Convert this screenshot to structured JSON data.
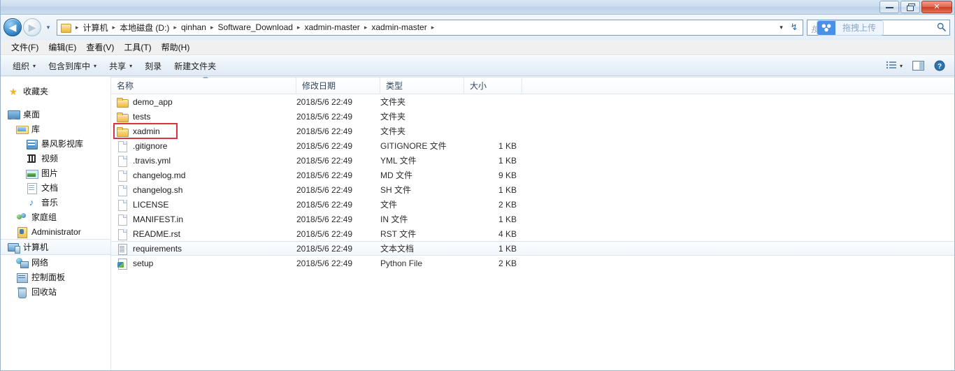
{
  "titlebar": {
    "minimize_label": "Minimize",
    "restore_label": "Restore",
    "close_label": "✕"
  },
  "nav": {
    "back_glyph": "◀",
    "forward_glyph": "▶",
    "recent_glyph": "▾",
    "address_dropdown_glyph": "▾",
    "refresh_glyph": "↯",
    "breadcrumbs": [
      "计算机",
      "本地磁盘 (D:)",
      "qinhan",
      "Software_Download",
      "xadmin-master",
      "xadmin-master"
    ],
    "separator": "▸"
  },
  "search": {
    "placeholder": "搜索",
    "baidu_overlay_text": "拖拽上传",
    "magnifier_glyph": "🔍",
    "accent_color": "#4a90e8"
  },
  "menubar": {
    "items": [
      "文件(F)",
      "编辑(E)",
      "查看(V)",
      "工具(T)",
      "帮助(H)"
    ]
  },
  "toolbar": {
    "items": [
      {
        "label": "组织",
        "has_caret": true
      },
      {
        "label": "包含到库中",
        "has_caret": true
      },
      {
        "label": "共享",
        "has_caret": true
      },
      {
        "label": "刻录",
        "has_caret": false
      },
      {
        "label": "新建文件夹",
        "has_caret": false
      }
    ],
    "caret_glyph": "▾",
    "view_icon": "list-view-icon",
    "preview_icon": "preview-pane-icon",
    "help_icon": "help-icon",
    "help_glyph": "?"
  },
  "sidebar": {
    "items": [
      {
        "label": "收藏夹",
        "icon": "star-icon",
        "depth": 0,
        "selected": false,
        "gap_after": true
      },
      {
        "label": "桌面",
        "icon": "monitor-icon",
        "depth": 0,
        "selected": false
      },
      {
        "label": "库",
        "icon": "library-icon",
        "depth": 1,
        "selected": false
      },
      {
        "label": "暴风影视库",
        "icon": "film-library-icon",
        "depth": 2,
        "selected": false
      },
      {
        "label": "视频",
        "icon": "video-icon",
        "depth": 2,
        "selected": false
      },
      {
        "label": "图片",
        "icon": "picture-icon",
        "depth": 2,
        "selected": false
      },
      {
        "label": "文档",
        "icon": "document-icon",
        "depth": 2,
        "selected": false
      },
      {
        "label": "音乐",
        "icon": "music-icon",
        "depth": 2,
        "selected": false
      },
      {
        "label": "家庭组",
        "icon": "homegroup-icon",
        "depth": 1,
        "selected": false
      },
      {
        "label": "Administrator",
        "icon": "user-icon",
        "depth": 1,
        "selected": false
      },
      {
        "label": "计算机",
        "icon": "computer-icon",
        "depth": 0,
        "selected": true
      },
      {
        "label": "网络",
        "icon": "network-icon",
        "depth": 1,
        "selected": false
      },
      {
        "label": "控制面板",
        "icon": "control-panel-icon",
        "depth": 1,
        "selected": false
      },
      {
        "label": "回收站",
        "icon": "recycle-bin-icon",
        "depth": 1,
        "selected": false
      }
    ]
  },
  "filelist": {
    "columns": [
      "名称",
      "修改日期",
      "类型",
      "大小"
    ],
    "sort_column": "名称",
    "sort_direction": "ascending",
    "rows": [
      {
        "name": "demo_app",
        "date": "2018/5/6 22:49",
        "type": "文件夹",
        "size": "",
        "icon": "folder-icon",
        "highlight": false,
        "annotated": false
      },
      {
        "name": "tests",
        "date": "2018/5/6 22:49",
        "type": "文件夹",
        "size": "",
        "icon": "folder-icon",
        "highlight": false,
        "annotated": false
      },
      {
        "name": "xadmin",
        "date": "2018/5/6 22:49",
        "type": "文件夹",
        "size": "",
        "icon": "folder-icon",
        "highlight": false,
        "annotated": true
      },
      {
        "name": ".gitignore",
        "date": "2018/5/6 22:49",
        "type": "GITIGNORE 文件",
        "size": "1 KB",
        "icon": "file-icon",
        "highlight": false,
        "annotated": false
      },
      {
        "name": ".travis.yml",
        "date": "2018/5/6 22:49",
        "type": "YML 文件",
        "size": "1 KB",
        "icon": "file-icon",
        "highlight": false,
        "annotated": false
      },
      {
        "name": "changelog.md",
        "date": "2018/5/6 22:49",
        "type": "MD 文件",
        "size": "9 KB",
        "icon": "file-icon",
        "highlight": false,
        "annotated": false
      },
      {
        "name": "changelog.sh",
        "date": "2018/5/6 22:49",
        "type": "SH 文件",
        "size": "1 KB",
        "icon": "file-icon",
        "highlight": false,
        "annotated": false
      },
      {
        "name": "LICENSE",
        "date": "2018/5/6 22:49",
        "type": "文件",
        "size": "2 KB",
        "icon": "file-icon",
        "highlight": false,
        "annotated": false
      },
      {
        "name": "MANIFEST.in",
        "date": "2018/5/6 22:49",
        "type": "IN 文件",
        "size": "1 KB",
        "icon": "file-icon",
        "highlight": false,
        "annotated": false
      },
      {
        "name": "README.rst",
        "date": "2018/5/6 22:49",
        "type": "RST 文件",
        "size": "4 KB",
        "icon": "file-icon",
        "highlight": false,
        "annotated": false
      },
      {
        "name": "requirements",
        "date": "2018/5/6 22:49",
        "type": "文本文档",
        "size": "1 KB",
        "icon": "text-document-icon",
        "highlight": true,
        "annotated": false
      },
      {
        "name": "setup",
        "date": "2018/5/6 22:49",
        "type": "Python File",
        "size": "2 KB",
        "icon": "python-file-icon",
        "highlight": false,
        "annotated": false
      }
    ]
  },
  "annotation": {
    "color": "#d9333f",
    "target_row": "xadmin"
  }
}
